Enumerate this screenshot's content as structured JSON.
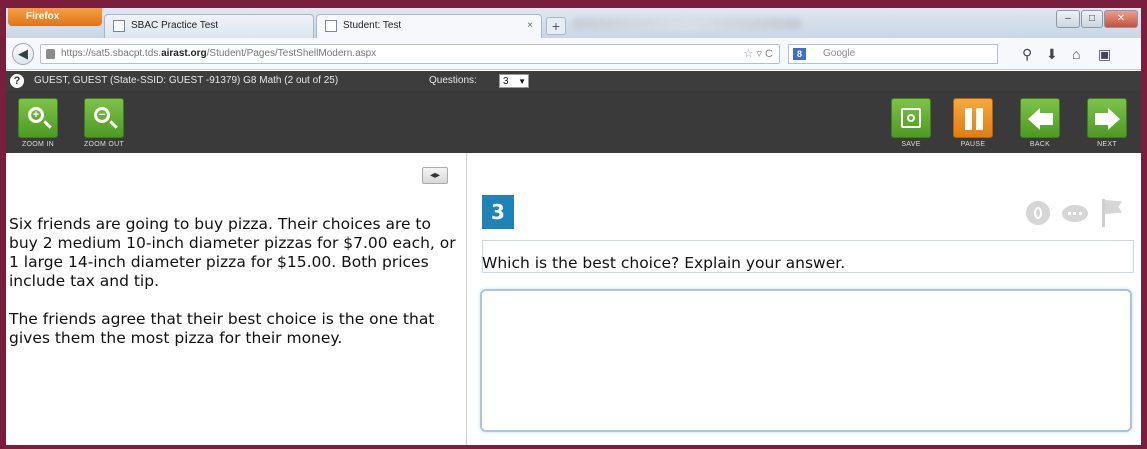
{
  "browser": {
    "menu_label": "Firefox",
    "tabs": [
      {
        "label": "SBAC Practice Test",
        "close": "×"
      },
      {
        "label": "Student: Test",
        "close": "×"
      }
    ],
    "new_tab": "+",
    "window_controls": [
      "–",
      "□",
      "✕"
    ],
    "url_prefix": "https://sat5.sbacpt.tds.",
    "url_domain": "airast.org",
    "url_path": "/Student/Pages/TestShellModern.aspx",
    "url_tools": "☆ ▿ C",
    "search_engine": "8",
    "search_placeholder": "Google"
  },
  "infobar": {
    "student": "GUEST, GUEST (State-SSID: GUEST -91379)  G8 Math (2 out of 25)",
    "questions_label": "Questions:",
    "question_value": "3"
  },
  "toolbar": {
    "zoom_in": "ZOOM IN",
    "zoom_out": "ZOOM OUT",
    "save": "SAVE",
    "pause": "PAUSE",
    "back": "BACK",
    "next": "NEXT"
  },
  "passage": {
    "p1": "Six friends are going to buy pizza. Their choices are to buy 2 medium 10-inch diameter pizzas for $7.00 each, or 1 large 14-inch diameter pizza for $15.00. Both prices include tax and tip.",
    "p2": "The friends agree that their best choice is the one that gives them the most pizza for their money."
  },
  "question": {
    "number": "3",
    "text": "Which is the best choice? Explain your answer."
  },
  "colors": {
    "accent_blue": "#1e84b8",
    "button_green": "#5aa52a",
    "button_orange": "#f0901f",
    "toolbar_dark": "#3a3a3a"
  }
}
